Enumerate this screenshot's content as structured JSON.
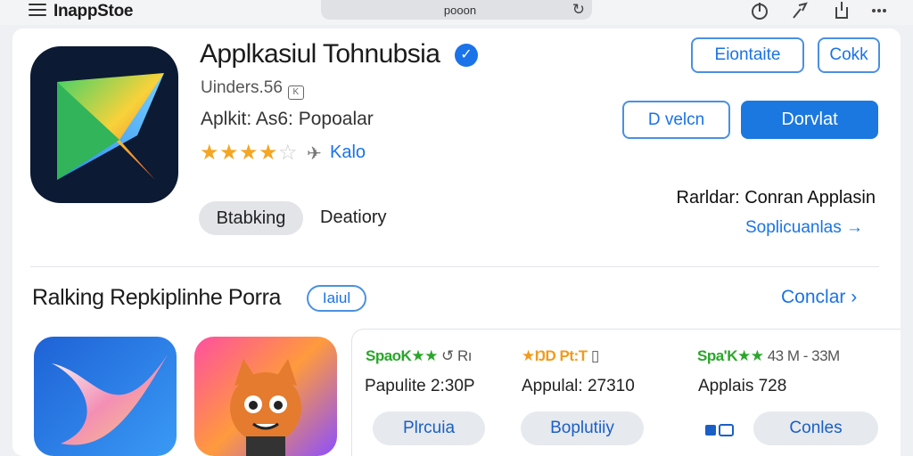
{
  "header": {
    "app_name": "InappStoe",
    "url": "pooon",
    "menu_icon": "hamburger-menu-icon",
    "reload_icon": "reload-icon",
    "icons": [
      "history-icon",
      "pin-icon",
      "share-icon",
      "more-icon"
    ]
  },
  "app": {
    "title": "Applkasiul Tohnubsia",
    "verified_icon": "verified-check-icon",
    "developer": "Uinders.56",
    "developer_badge": "K",
    "subtitle": "Aplkit: As6: Popoalar",
    "stars": 4,
    "rating_link": "Kalo"
  },
  "tags": {
    "chip": "Btabking",
    "category": "Deatiory"
  },
  "actions": {
    "outline1": "Eiontaite",
    "outline2": "Cokk",
    "outline3": "D velcn",
    "primary": "Dorvlat"
  },
  "related": {
    "label": "Rarldar: Conran Applasin",
    "link": "Soplicuanlas →"
  },
  "section": {
    "title": "Ralking Repkiplinhe Porra",
    "badge": "Iaiul",
    "see_all": "Conclar  ›"
  },
  "cards": [
    {
      "rating_g": "SpaoK",
      "rating_stars": "★★",
      "rating_rest": " ↺  Rı",
      "stat": "Papulite 2:30P",
      "button": "Plrcuia"
    },
    {
      "rating_o": "★ŊD Pt:T",
      "rating_rest": " ▯",
      "stat": "Appulal: 27310",
      "button": "Boplutiiy"
    },
    {
      "rating_g": "SpaʹK",
      "rating_stars": "★★",
      "rating_rest": " 43  M  -  33M",
      "stat": "Applais 728",
      "button": "Conles"
    }
  ],
  "colors": {
    "accent": "#1a73e8",
    "star": "#f5a623",
    "green": "#2aa62a"
  }
}
